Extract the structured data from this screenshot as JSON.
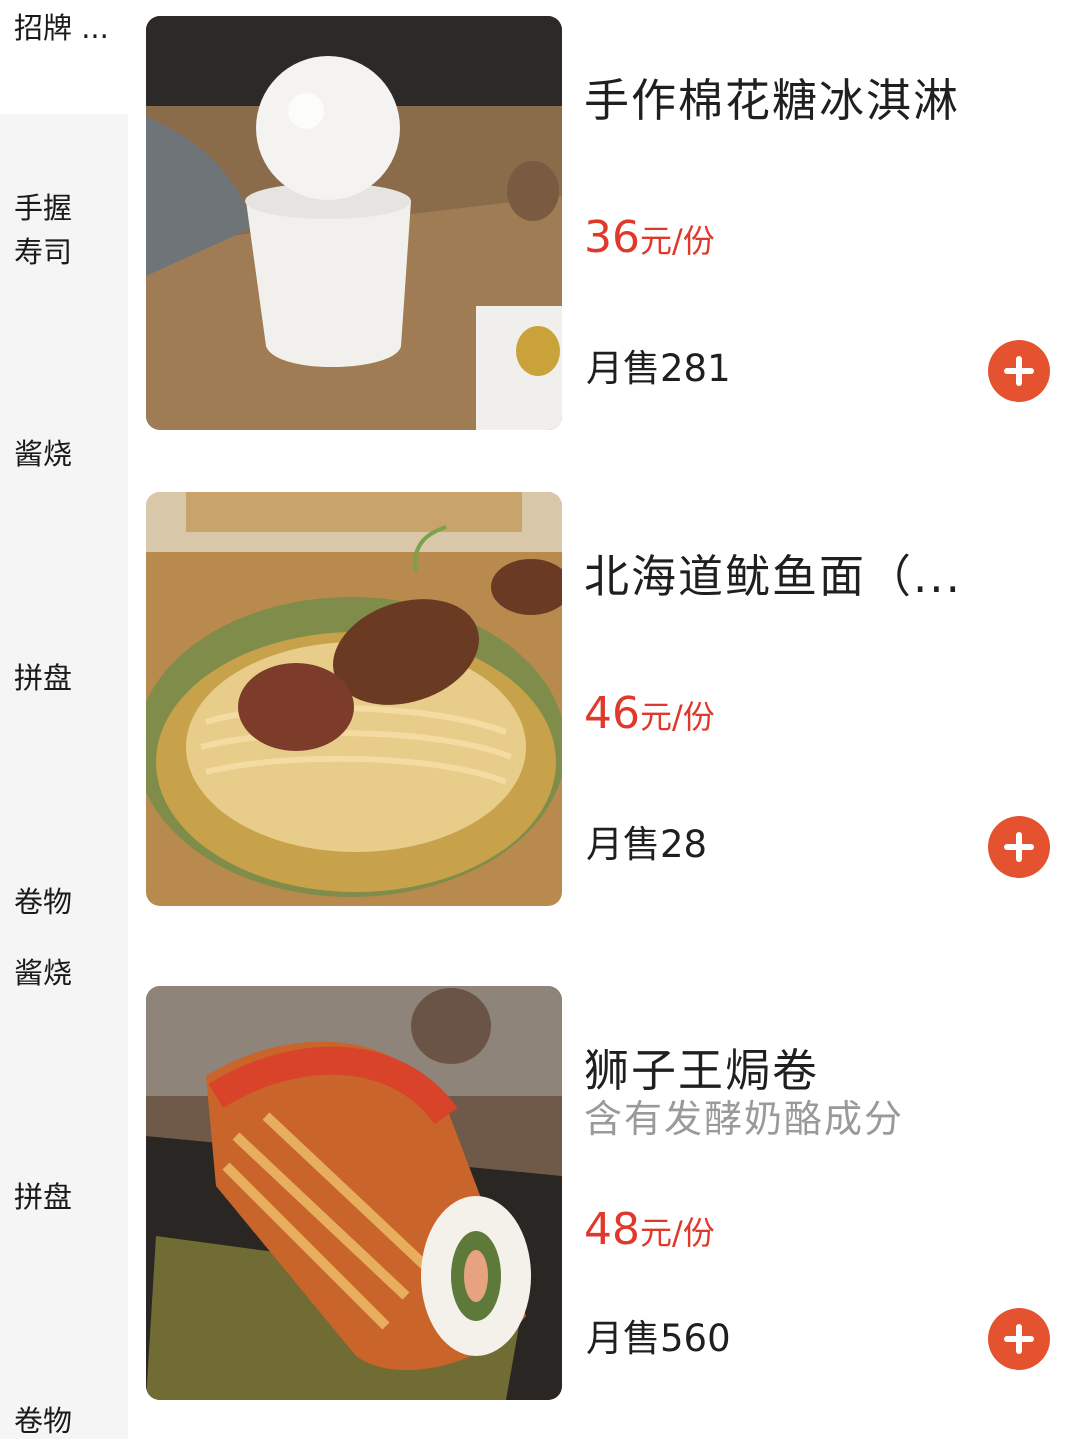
{
  "sidebar": {
    "categories": [
      {
        "label": "招牌 ..."
      },
      {
        "label": "手握\n寿司"
      },
      {
        "label": "酱烧"
      },
      {
        "label": "拼盘"
      },
      {
        "label": "卷物"
      },
      {
        "label": "酱烧"
      },
      {
        "label": "拼盘"
      },
      {
        "label": "卷物"
      }
    ]
  },
  "items": [
    {
      "name": "手作棉花糖冰淇淋",
      "price": "36",
      "price_unit": "元/份",
      "sales": "月售281",
      "image": "dessert-photo"
    },
    {
      "name": "北海道鱿鱼面（...",
      "price": "46",
      "price_unit": "元/份",
      "sales": "月售28",
      "image": "squid-noodle-photo"
    },
    {
      "name": "狮子王焗卷",
      "desc": "含有发酵奶酪成分",
      "price": "48",
      "price_unit": "元/份",
      "sales": "月售560",
      "image": "baked-roll-photo"
    }
  ],
  "colors": {
    "price": "#e0392c",
    "add_button": "#e4522f",
    "sidebar_bg": "#f5f5f5"
  },
  "icons": {
    "add": "plus-icon"
  }
}
